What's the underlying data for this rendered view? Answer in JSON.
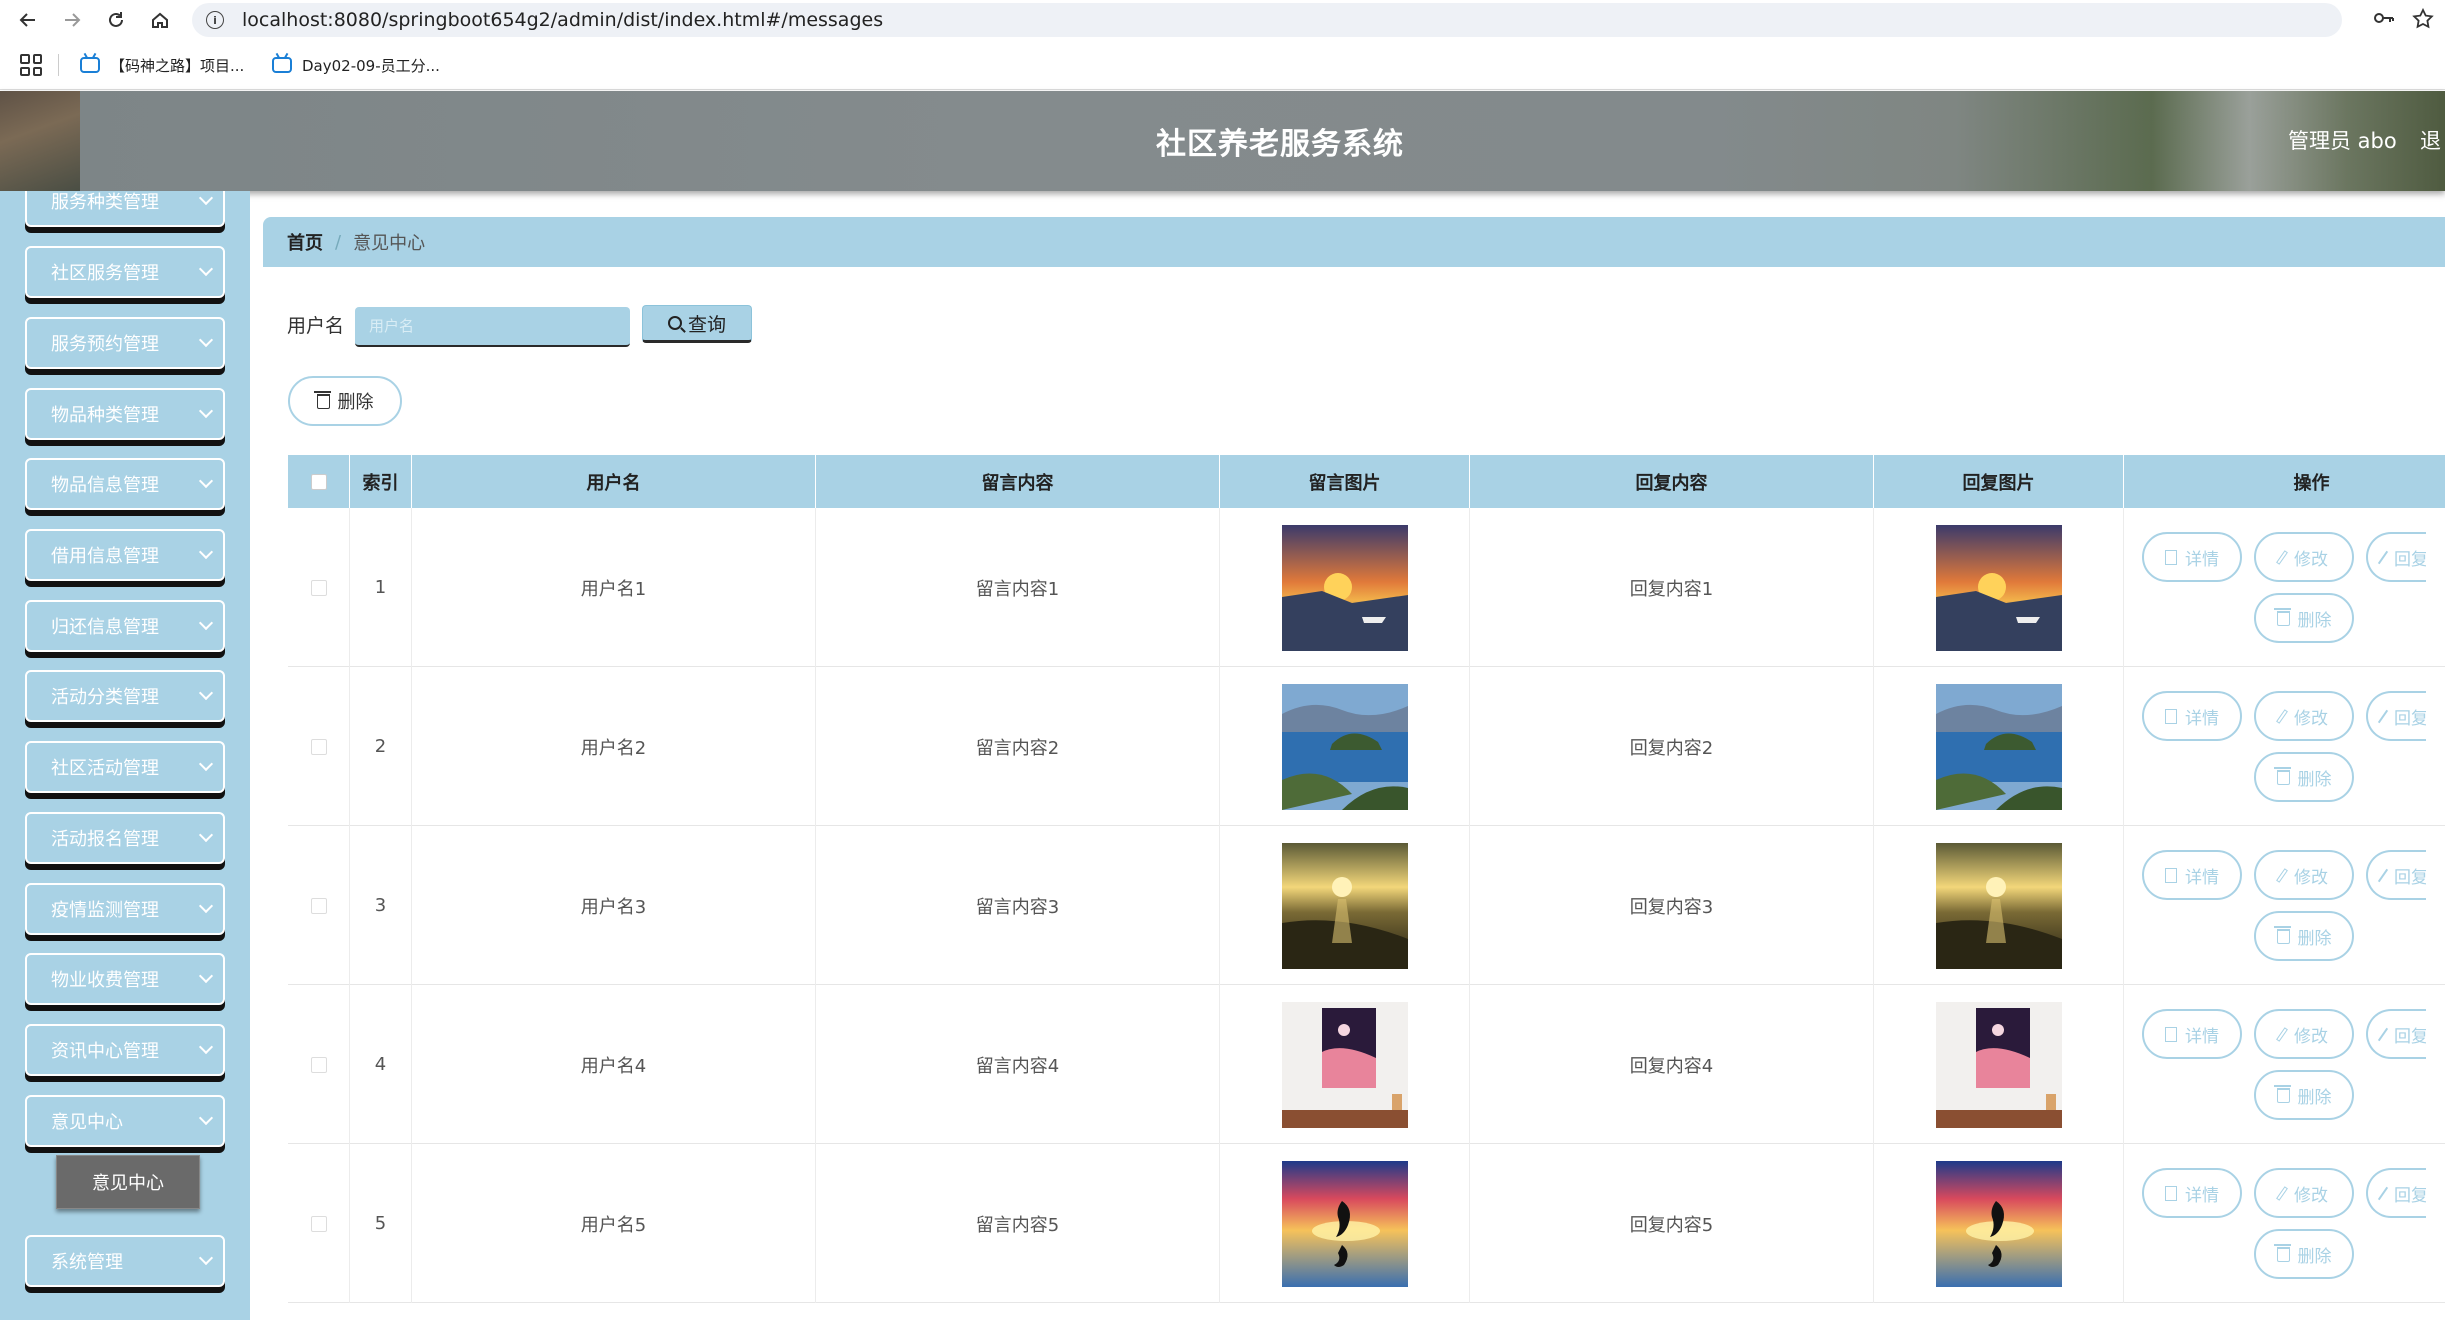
{
  "browser": {
    "url": "localhost:8080/springboot654g2/admin/dist/index.html#/messages",
    "bookmarks": [
      "【码神之路】项目...",
      "Day02-09-员工分..."
    ]
  },
  "header": {
    "title": "社区养老服务系统",
    "user": "管理员 abo",
    "logout": "退"
  },
  "sidebar": {
    "items": [
      {
        "label": "服务种类管理"
      },
      {
        "label": "社区服务管理"
      },
      {
        "label": "服务预约管理"
      },
      {
        "label": "物品种类管理"
      },
      {
        "label": "物品信息管理"
      },
      {
        "label": "借用信息管理"
      },
      {
        "label": "归还信息管理"
      },
      {
        "label": "活动分类管理"
      },
      {
        "label": "社区活动管理"
      },
      {
        "label": "活动报名管理"
      },
      {
        "label": "疫情监测管理"
      },
      {
        "label": "物业收费管理"
      },
      {
        "label": "资讯中心管理"
      },
      {
        "label": "意见中心"
      },
      {
        "label": "系统管理"
      }
    ],
    "active_sub": "意见中心"
  },
  "breadcrumb": {
    "home": "首页",
    "separator": "/",
    "current": "意见中心"
  },
  "search": {
    "label": "用户名",
    "placeholder": "用户名",
    "button": "查询"
  },
  "toolbar": {
    "delete_label": "删除"
  },
  "table": {
    "columns": [
      "索引",
      "用户名",
      "留言内容",
      "留言图片",
      "回复内容",
      "回复图片",
      "操作"
    ],
    "rows": [
      {
        "index": "1",
        "user": "用户名1",
        "content": "留言内容1",
        "reply": "回复内容1",
        "img": "sunset-boat"
      },
      {
        "index": "2",
        "user": "用户名2",
        "content": "留言内容2",
        "reply": "回复内容2",
        "img": "lake-island"
      },
      {
        "index": "3",
        "user": "用户名3",
        "content": "留言内容3",
        "reply": "回复内容3",
        "img": "beach-sunset"
      },
      {
        "index": "4",
        "user": "用户名4",
        "content": "留言内容4",
        "reply": "回复内容4",
        "img": "pink-poster"
      },
      {
        "index": "5",
        "user": "用户名5",
        "content": "留言内容5",
        "reply": "回复内容5",
        "img": "dolphin-sunset"
      }
    ],
    "actions": {
      "detail": "详情",
      "edit": "修改",
      "reply": "回复",
      "delete": "删除"
    }
  },
  "colors": {
    "accent": "#a9d2e5",
    "header": "#848b8d",
    "sub_active": "#6a6a6a"
  }
}
